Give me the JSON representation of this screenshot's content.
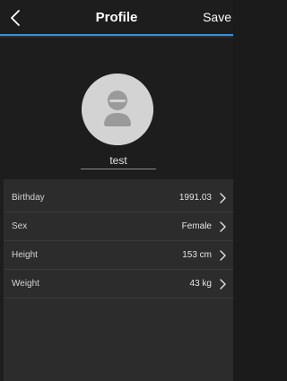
{
  "navbar": {
    "back_icon": "chevron-left-icon",
    "title": "Profile",
    "save_label": "Save",
    "accent_color": "#3a8fd9"
  },
  "profile": {
    "avatar_icon": "user-avatar-icon",
    "username": "test"
  },
  "fields": [
    {
      "label": "Birthday",
      "value": "1991.03",
      "icon": "chevron-right-icon"
    },
    {
      "label": "Sex",
      "value": "Female",
      "icon": "chevron-right-icon"
    },
    {
      "label": "Height",
      "value": "153 cm",
      "icon": "chevron-right-icon"
    },
    {
      "label": "Weight",
      "value": "43 kg",
      "icon": "chevron-right-icon"
    }
  ]
}
